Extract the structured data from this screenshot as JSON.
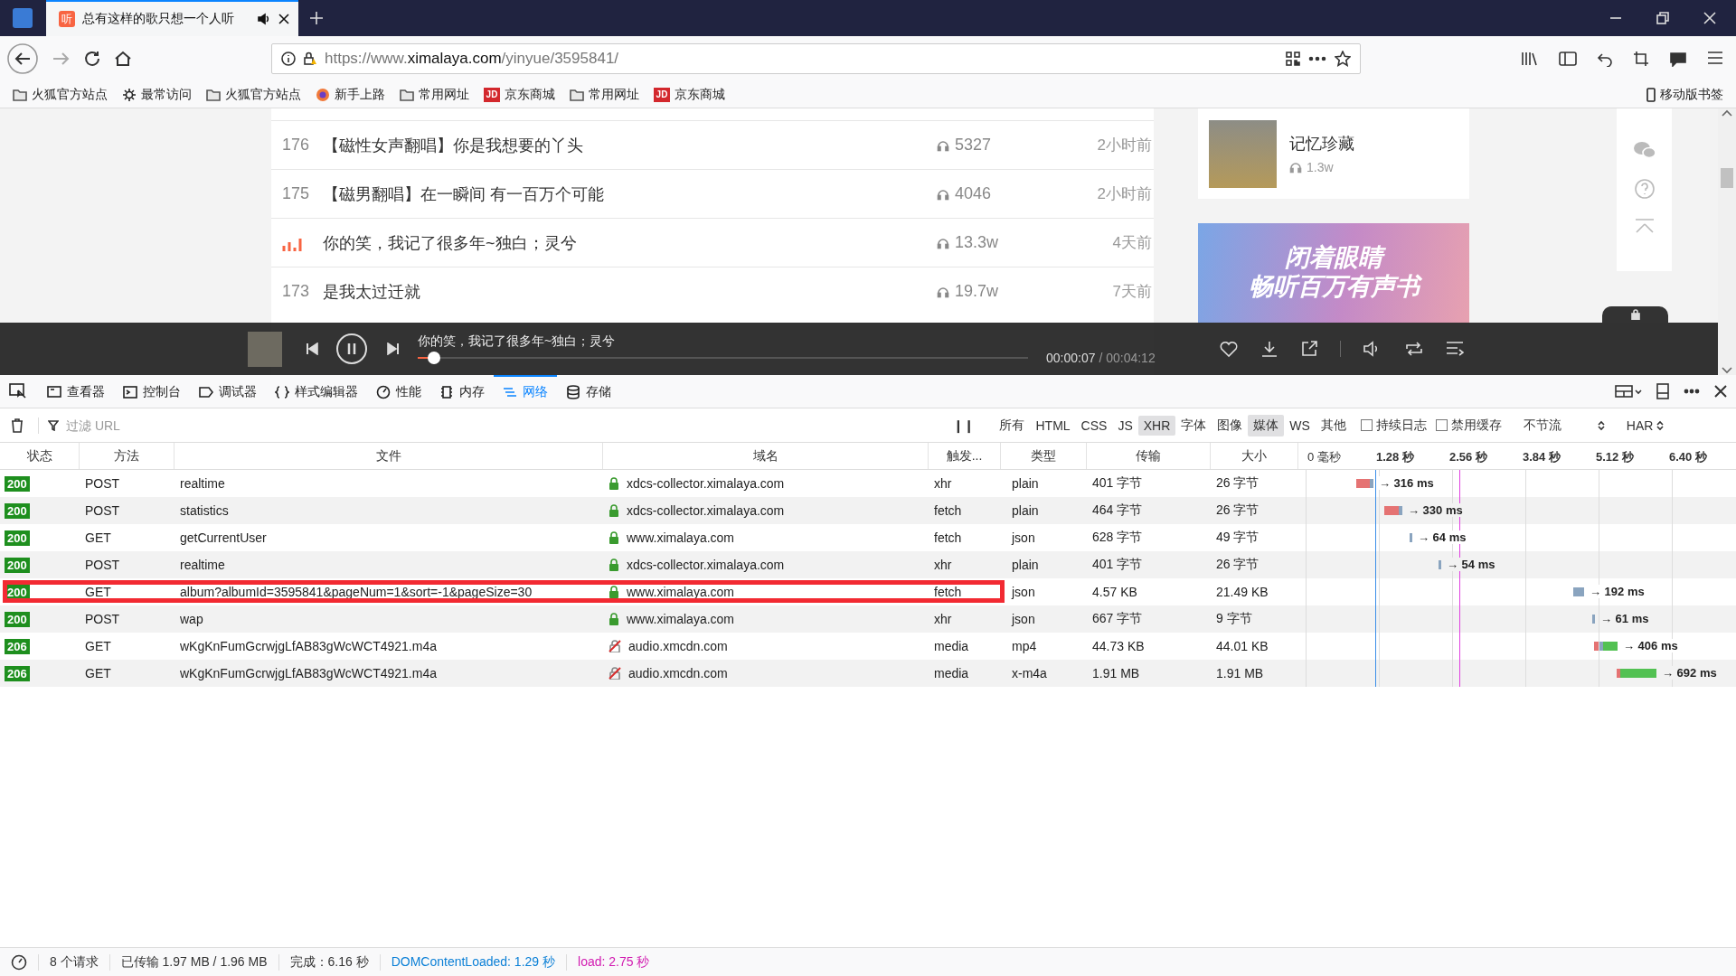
{
  "browser": {
    "tab": {
      "title": "总有这样的歌只想一个人听",
      "favicon": "听"
    },
    "url": {
      "prefix": "https://www.",
      "domain": "ximalaya.com",
      "path": "/yinyue/3595841/"
    },
    "bookmarks": [
      {
        "label": "火狐官方站点",
        "kind": "folder"
      },
      {
        "label": "最常访问",
        "kind": "gear"
      },
      {
        "label": "火狐官方站点",
        "kind": "folder"
      },
      {
        "label": "新手上路",
        "kind": "globe"
      },
      {
        "label": "常用网址",
        "kind": "folder"
      },
      {
        "label": "京东商城",
        "kind": "jd",
        "badge": "JD"
      },
      {
        "label": "常用网址",
        "kind": "folder"
      },
      {
        "label": "京东商城",
        "kind": "jd",
        "badge": "JD"
      }
    ],
    "mobile_bookmarks": "移动版书签"
  },
  "page": {
    "songs": [
      {
        "number": "176",
        "title": "【磁性女声翻唱】你是我想要的丫头",
        "plays": "5327",
        "time": "2小时前",
        "playing": false
      },
      {
        "number": "175",
        "title": "【磁男翻唱】在一瞬间 有一百万个可能",
        "plays": "4046",
        "time": "2小时前",
        "playing": false
      },
      {
        "title": "你的笑，我记了很多年~独白；灵兮",
        "plays": "13.3w",
        "time": "4天前",
        "playing": true
      },
      {
        "number": "173",
        "title": "是我太过迁就",
        "plays": "19.7w",
        "time": "7天前",
        "playing": false
      }
    ],
    "album": {
      "title": "记忆珍藏",
      "plays": "1.3w"
    },
    "banner": {
      "lines": [
        "闭着眼睛",
        "畅听百万有声书"
      ]
    },
    "player": {
      "title": "你的笑，我记了很多年~独白；灵兮",
      "playing": true,
      "level": 0.027,
      "current": "00:00:07",
      "total": "/ 00:04:12"
    }
  },
  "devtools": {
    "tabs": [
      {
        "label": "查看器",
        "selected": false
      },
      {
        "label": "控制台",
        "selected": false
      },
      {
        "label": "调试器",
        "selected": false
      },
      {
        "label": "样式编辑器",
        "selected": false
      },
      {
        "label": "性能",
        "selected": false
      },
      {
        "label": "内存",
        "selected": false
      },
      {
        "label": "网络",
        "selected": true
      },
      {
        "label": "存储",
        "selected": false
      }
    ],
    "filter": {
      "placeholder": "过滤 URL"
    },
    "pause": "❙❙",
    "type_filters": [
      {
        "label": "所有",
        "selected": false
      },
      {
        "label": "HTML",
        "selected": false
      },
      {
        "label": "CSS",
        "selected": false
      },
      {
        "label": "JS",
        "selected": false
      },
      {
        "label": "XHR",
        "selected": true
      },
      {
        "label": "字体",
        "selected": false
      },
      {
        "label": "图像",
        "selected": false
      },
      {
        "label": "媒体",
        "selected": true
      },
      {
        "label": "WS",
        "selected": false
      },
      {
        "label": "其他",
        "selected": false
      }
    ],
    "options": [
      {
        "label": "持续日志",
        "checked": false
      },
      {
        "label": "禁用缓存",
        "checked": false
      }
    ],
    "throttle": "不节流",
    "har": "HAR",
    "columns": [
      "状态",
      "方法",
      "文件",
      "域名",
      "触发...",
      "类型",
      "传输",
      "大小"
    ],
    "timeline_ticks": [
      "0 毫秒",
      "1.28 秒",
      "2.56 秒",
      "3.84 秒",
      "5.12 秒",
      "6.40 秒"
    ],
    "requests": [
      {
        "status": "200",
        "method": "POST",
        "file": "realtime",
        "secure": true,
        "domain": "xdcs-collector.ximalaya.com",
        "cause": "xhr",
        "type": "plain",
        "transferred": "401 字节",
        "size": "26 字节",
        "timing": "→ 316 ms",
        "highlighted": false
      },
      {
        "status": "200",
        "method": "POST",
        "file": "statistics",
        "secure": true,
        "domain": "xdcs-collector.ximalaya.com",
        "cause": "fetch",
        "type": "plain",
        "transferred": "464 字节",
        "size": "26 字节",
        "timing": "→ 330 ms",
        "highlighted": false
      },
      {
        "status": "200",
        "method": "GET",
        "file": "getCurrentUser",
        "secure": true,
        "domain": "www.ximalaya.com",
        "cause": "fetch",
        "type": "json",
        "transferred": "628 字节",
        "size": "49 字节",
        "timing": "→ 64 ms",
        "highlighted": false
      },
      {
        "status": "200",
        "method": "POST",
        "file": "realtime",
        "secure": true,
        "domain": "xdcs-collector.ximalaya.com",
        "cause": "xhr",
        "type": "plain",
        "transferred": "401 字节",
        "size": "26 字节",
        "timing": "→ 54 ms",
        "highlighted": false
      },
      {
        "status": "200",
        "method": "GET",
        "file": "album?albumId=3595841&pageNum=1&sort=-1&pageSize=30",
        "secure": true,
        "domain": "www.ximalaya.com",
        "cause": "fetch",
        "type": "json",
        "transferred": "4.57 KB",
        "size": "21.49 KB",
        "timing": "→ 192 ms",
        "highlighted": true
      },
      {
        "status": "200",
        "method": "POST",
        "file": "wap",
        "secure": true,
        "domain": "www.ximalaya.com",
        "cause": "xhr",
        "type": "json",
        "transferred": "667 字节",
        "size": "9 字节",
        "timing": "→ 61 ms",
        "highlighted": false
      },
      {
        "status": "206",
        "method": "GET",
        "file": "wKgKnFumGcrwjgLfAB83gWcWCT4921.m4a",
        "secure": false,
        "domain": "audio.xmcdn.com",
        "cause": "media",
        "type": "mp4",
        "transferred": "44.73 KB",
        "size": "44.01 KB",
        "timing": "→ 406 ms",
        "highlighted": false
      },
      {
        "status": "206",
        "method": "GET",
        "file": "wKgKnFumGcrwjgLfAB83gWcWCT4921.m4a",
        "secure": false,
        "domain": "audio.xmcdn.com",
        "cause": "media",
        "type": "x-m4a",
        "transferred": "1.91 MB",
        "size": "1.91 MB",
        "timing": "→ 692 ms",
        "highlighted": false
      }
    ],
    "status_bar": {
      "requests": "8 个请求",
      "transferred": "已传输 1.97 MB / 1.96 MB",
      "finish": "完成：6.16 秒",
      "dom_loaded": "DOMContentLoaded: 1.29 秒",
      "load": "load: 2.75 秒"
    }
  }
}
